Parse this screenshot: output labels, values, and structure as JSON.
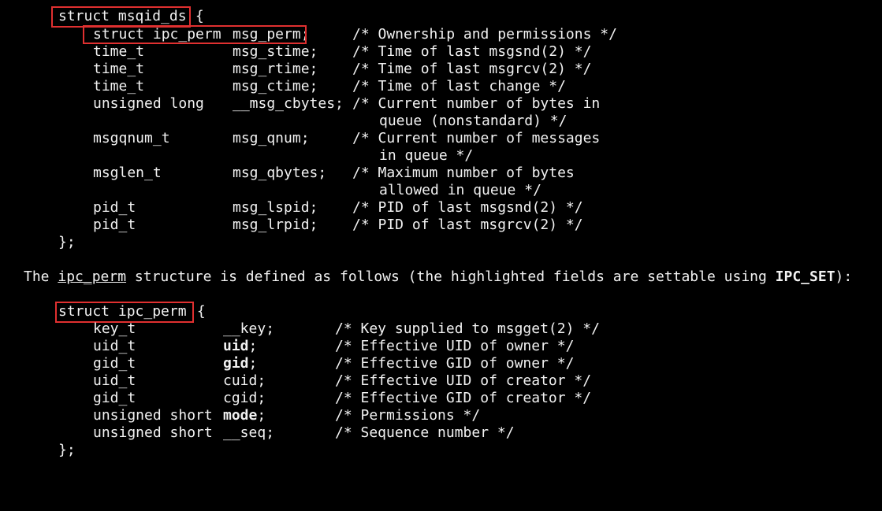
{
  "colors": {
    "background": "#000000",
    "text": "#f2f2f2",
    "highlight_box": "#e03030"
  },
  "msqid_ds": {
    "header": "struct msqid_ds",
    "open_brace": " {",
    "close": "};",
    "fields": [
      {
        "type": "struct ipc_perm",
        "name": "msg_perm;",
        "comment": "/* Ownership and permissions */"
      },
      {
        "type": "time_t",
        "name": "msg_stime;",
        "comment": "/* Time of last msgsnd(2) */"
      },
      {
        "type": "time_t",
        "name": "msg_rtime;",
        "comment": "/* Time of last msgrcv(2) */"
      },
      {
        "type": "time_t",
        "name": "msg_ctime;",
        "comment": "/* Time of last change */"
      },
      {
        "type": "unsigned long",
        "name": "__msg_cbytes;",
        "comment": "/* Current number of bytes in",
        "comment2": "queue (nonstandard) */"
      },
      {
        "type": "msgqnum_t",
        "name": "msg_qnum;",
        "comment": "/* Current number of messages",
        "comment2": "in queue */"
      },
      {
        "type": "msglen_t",
        "name": "msg_qbytes;",
        "comment": "/* Maximum number of bytes",
        "comment2": "allowed in queue */"
      },
      {
        "type": "pid_t",
        "name": "msg_lspid;",
        "comment": "/* PID of last msgsnd(2) */"
      },
      {
        "type": "pid_t",
        "name": "msg_lrpid;",
        "comment": "/* PID of last msgrcv(2) */"
      }
    ]
  },
  "prose": {
    "part1": "The ",
    "link": "ipc_perm",
    "part2": " structure is defined as follows (the highlighted fields are settable using ",
    "bold": "IPC_SET",
    "part3": "):"
  },
  "ipc_perm": {
    "header": "struct ipc_perm",
    "open_brace": " {",
    "close": "};",
    "fields": [
      {
        "type": "key_t",
        "name": "__key",
        "semi": ";",
        "comment": "/* Key supplied to msgget(2) */"
      },
      {
        "type": "uid_t",
        "name": "uid",
        "semi": ";",
        "comment": "/* Effective UID of owner */"
      },
      {
        "type": "gid_t",
        "name": "gid",
        "semi": ";",
        "comment": "/* Effective GID of owner */"
      },
      {
        "type": "uid_t",
        "name": "cuid",
        "semi": ";",
        "comment": "/* Effective UID of creator */"
      },
      {
        "type": "gid_t",
        "name": "cgid",
        "semi": ";",
        "comment": "/* Effective GID of creator */"
      },
      {
        "type": "unsigned short",
        "name": "mode",
        "semi": ";",
        "comment": "/* Permissions */"
      },
      {
        "type": "unsigned short",
        "name": "__seq",
        "semi": ";",
        "comment": "/* Sequence number */"
      }
    ]
  }
}
